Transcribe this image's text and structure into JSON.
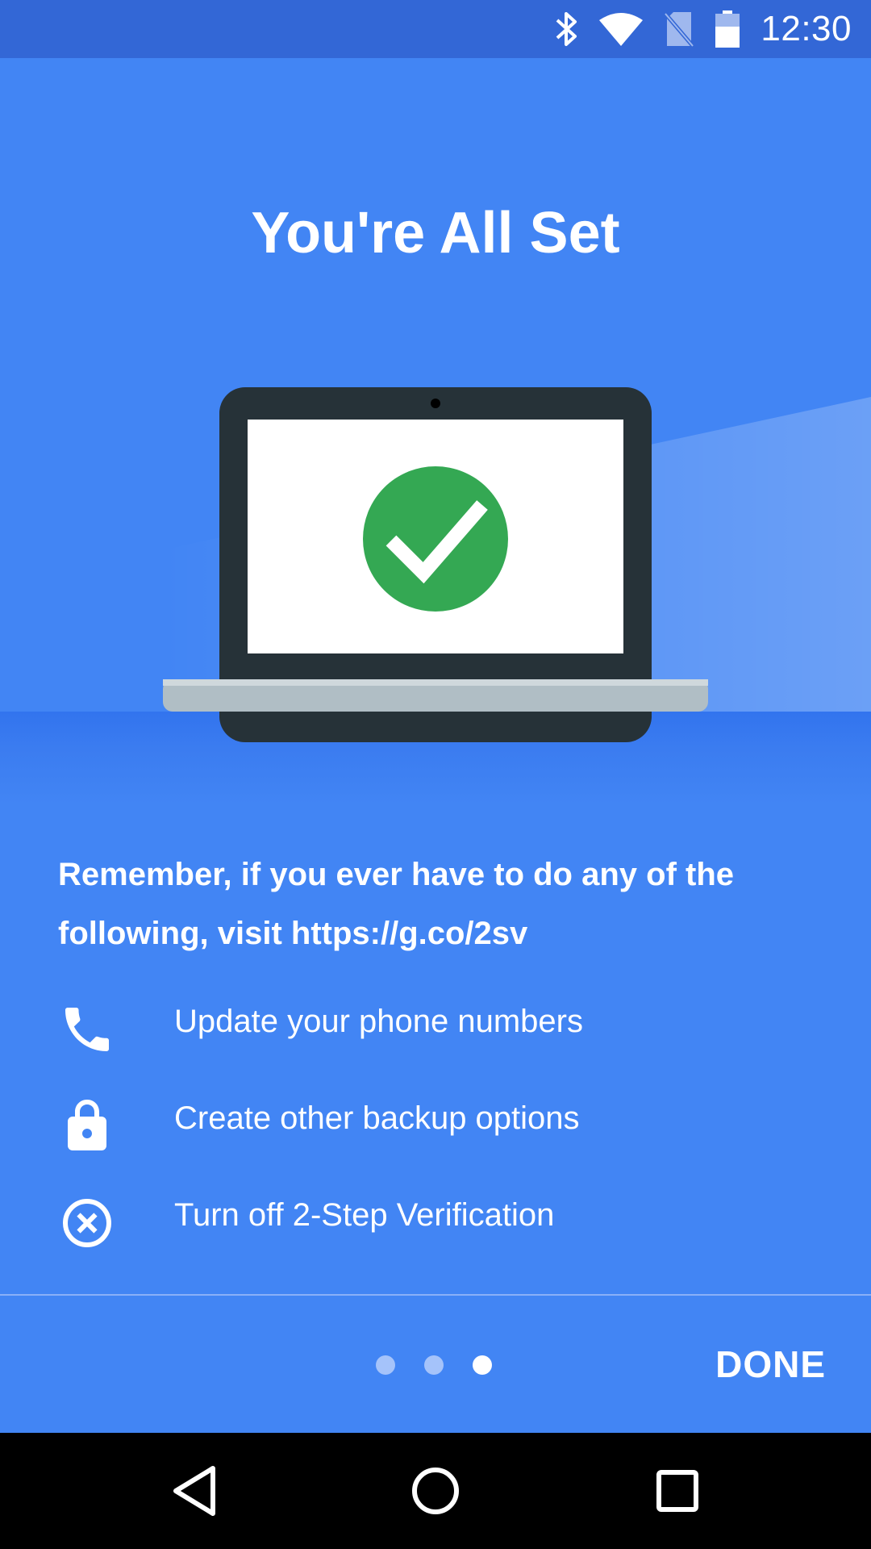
{
  "status_bar": {
    "time": "12:30",
    "icons": [
      "bluetooth-icon",
      "wifi-icon",
      "no-sim-icon",
      "battery-icon"
    ]
  },
  "hero": {
    "title": "You're All Set",
    "illustration": "laptop-with-checkmark"
  },
  "info": {
    "message": "Remember, if you ever have to do any of the following, visit https://g.co/2sv",
    "items": [
      {
        "icon": "phone-icon",
        "label": "Update your phone numbers"
      },
      {
        "icon": "lock-icon",
        "label": "Create other backup options"
      },
      {
        "icon": "cancel-circle-icon",
        "label": "Turn off 2-Step Verification"
      }
    ]
  },
  "footer": {
    "page_count": 3,
    "current_page": 3,
    "done_label": "DONE"
  },
  "nav_bar": {
    "buttons": [
      "back-icon",
      "home-icon",
      "recents-icon"
    ]
  },
  "colors": {
    "background": "#4285f4",
    "status_bar": "#3367d6",
    "check_green": "#34a853",
    "laptop_dark": "#263238",
    "laptop_base": "#b0bec5"
  }
}
